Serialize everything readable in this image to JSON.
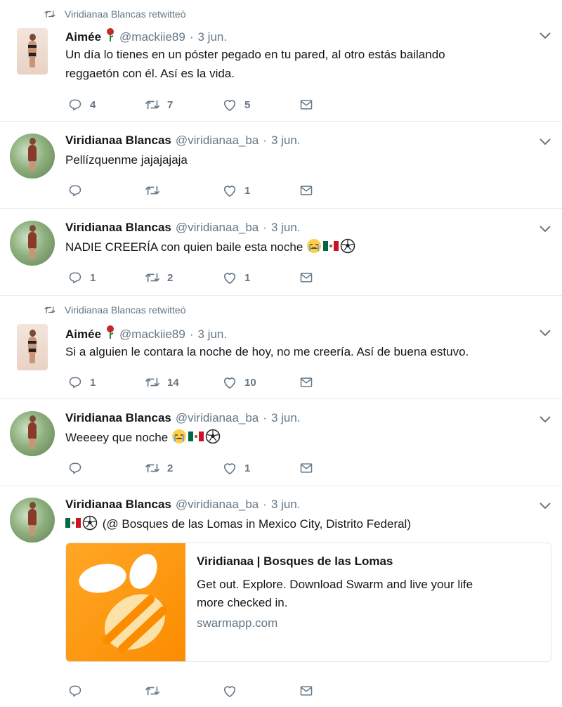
{
  "retweet_text": "Viridianaa Blancas retwitteó",
  "tweets": [
    {
      "name": "Aimée",
      "handle": "@mackiie89",
      "sep": "·",
      "time": "3 jun.",
      "text1": "Un día lo tienes en un póster pegado en tu pared, al otro estás bailando",
      "text2": "reggaetón con él. Así es la vida.",
      "replies": "4",
      "retweets": "7",
      "likes": "5"
    },
    {
      "name": "Viridianaa Blancas",
      "handle": "@viridianaa_ba",
      "sep": "·",
      "time": "3 jun.",
      "text1": "Pellízquenme jajajajaja",
      "replies": "",
      "retweets": "",
      "likes": "1"
    },
    {
      "name": "Viridianaa Blancas",
      "handle": "@viridianaa_ba",
      "sep": "·",
      "time": "3 jun.",
      "text1": "NADIE CREERÍA con quien baile esta noche",
      "replies": "1",
      "retweets": "2",
      "likes": "1"
    },
    {
      "name": "Aimée",
      "handle": "@mackiie89",
      "sep": "·",
      "time": "3 jun.",
      "text1": "Si a alguien le contara la noche de hoy, no me creería. Así de buena estuvo.",
      "replies": "1",
      "retweets": "14",
      "likes": "10"
    },
    {
      "name": "Viridianaa Blancas",
      "handle": "@viridianaa_ba",
      "sep": "·",
      "time": "3 jun.",
      "text1": "Weeeey que noche",
      "replies": "",
      "retweets": "2",
      "likes": "1"
    },
    {
      "name": "Viridianaa Blancas",
      "handle": "@viridianaa_ba",
      "sep": "·",
      "time": "3 jun.",
      "text1": "(@ Bosques de las Lomas in Mexico City, Distrito Federal)",
      "replies": "",
      "retweets": "",
      "likes": ""
    }
  ],
  "card": {
    "title": "Viridianaa | Bosques de las Lomas",
    "desc1": "Get out. Explore. Download Swarm and live your life",
    "desc2": "more checked in.",
    "domain": "swarmapp.com"
  },
  "colors": {
    "text": "#14171a",
    "muted": "#657786",
    "divider": "#e6ecf0",
    "swarm_orange": "#ffa726"
  }
}
